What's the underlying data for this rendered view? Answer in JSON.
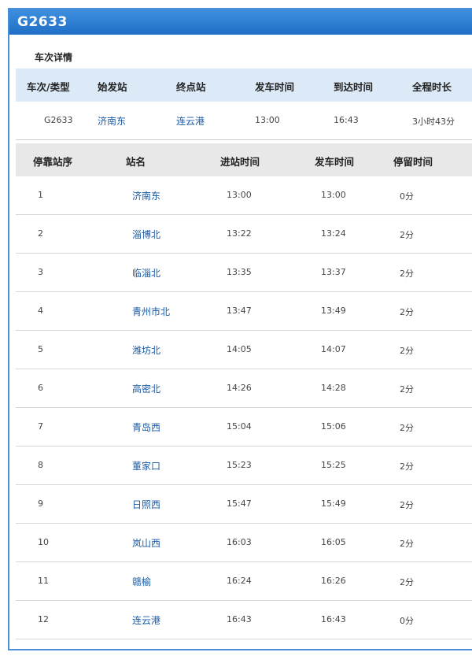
{
  "header": {
    "title": "G2633"
  },
  "section_title": "车次详情",
  "summary": {
    "columns": [
      "车次/类型",
      "始发站",
      "终点站",
      "发车时间",
      "到达时间",
      "全程时长"
    ],
    "train": "G2633",
    "origin": "济南东",
    "destination": "连云港",
    "depart": "13:00",
    "arrive": "16:43",
    "duration": "3小时43分"
  },
  "stops": {
    "columns": [
      "停靠站序",
      "站名",
      "进站时间",
      "发车时间",
      "停留时间"
    ],
    "rows": [
      {
        "seq": "1",
        "name": "济南东",
        "arr": "13:00",
        "dep": "13:00",
        "stay": "0分"
      },
      {
        "seq": "2",
        "name": "淄博北",
        "arr": "13:22",
        "dep": "13:24",
        "stay": "2分"
      },
      {
        "seq": "3",
        "name": "临淄北",
        "arr": "13:35",
        "dep": "13:37",
        "stay": "2分"
      },
      {
        "seq": "4",
        "name": "青州市北",
        "arr": "13:47",
        "dep": "13:49",
        "stay": "2分"
      },
      {
        "seq": "5",
        "name": "潍坊北",
        "arr": "14:05",
        "dep": "14:07",
        "stay": "2分"
      },
      {
        "seq": "6",
        "name": "高密北",
        "arr": "14:26",
        "dep": "14:28",
        "stay": "2分"
      },
      {
        "seq": "7",
        "name": "青岛西",
        "arr": "15:04",
        "dep": "15:06",
        "stay": "2分"
      },
      {
        "seq": "8",
        "name": "董家口",
        "arr": "15:23",
        "dep": "15:25",
        "stay": "2分"
      },
      {
        "seq": "9",
        "name": "日照西",
        "arr": "15:47",
        "dep": "15:49",
        "stay": "2分"
      },
      {
        "seq": "10",
        "name": "岚山西",
        "arr": "16:03",
        "dep": "16:05",
        "stay": "2分"
      },
      {
        "seq": "11",
        "name": "赣榆",
        "arr": "16:24",
        "dep": "16:26",
        "stay": "2分"
      },
      {
        "seq": "12",
        "name": "连云港",
        "arr": "16:43",
        "dep": "16:43",
        "stay": "0分"
      }
    ]
  }
}
